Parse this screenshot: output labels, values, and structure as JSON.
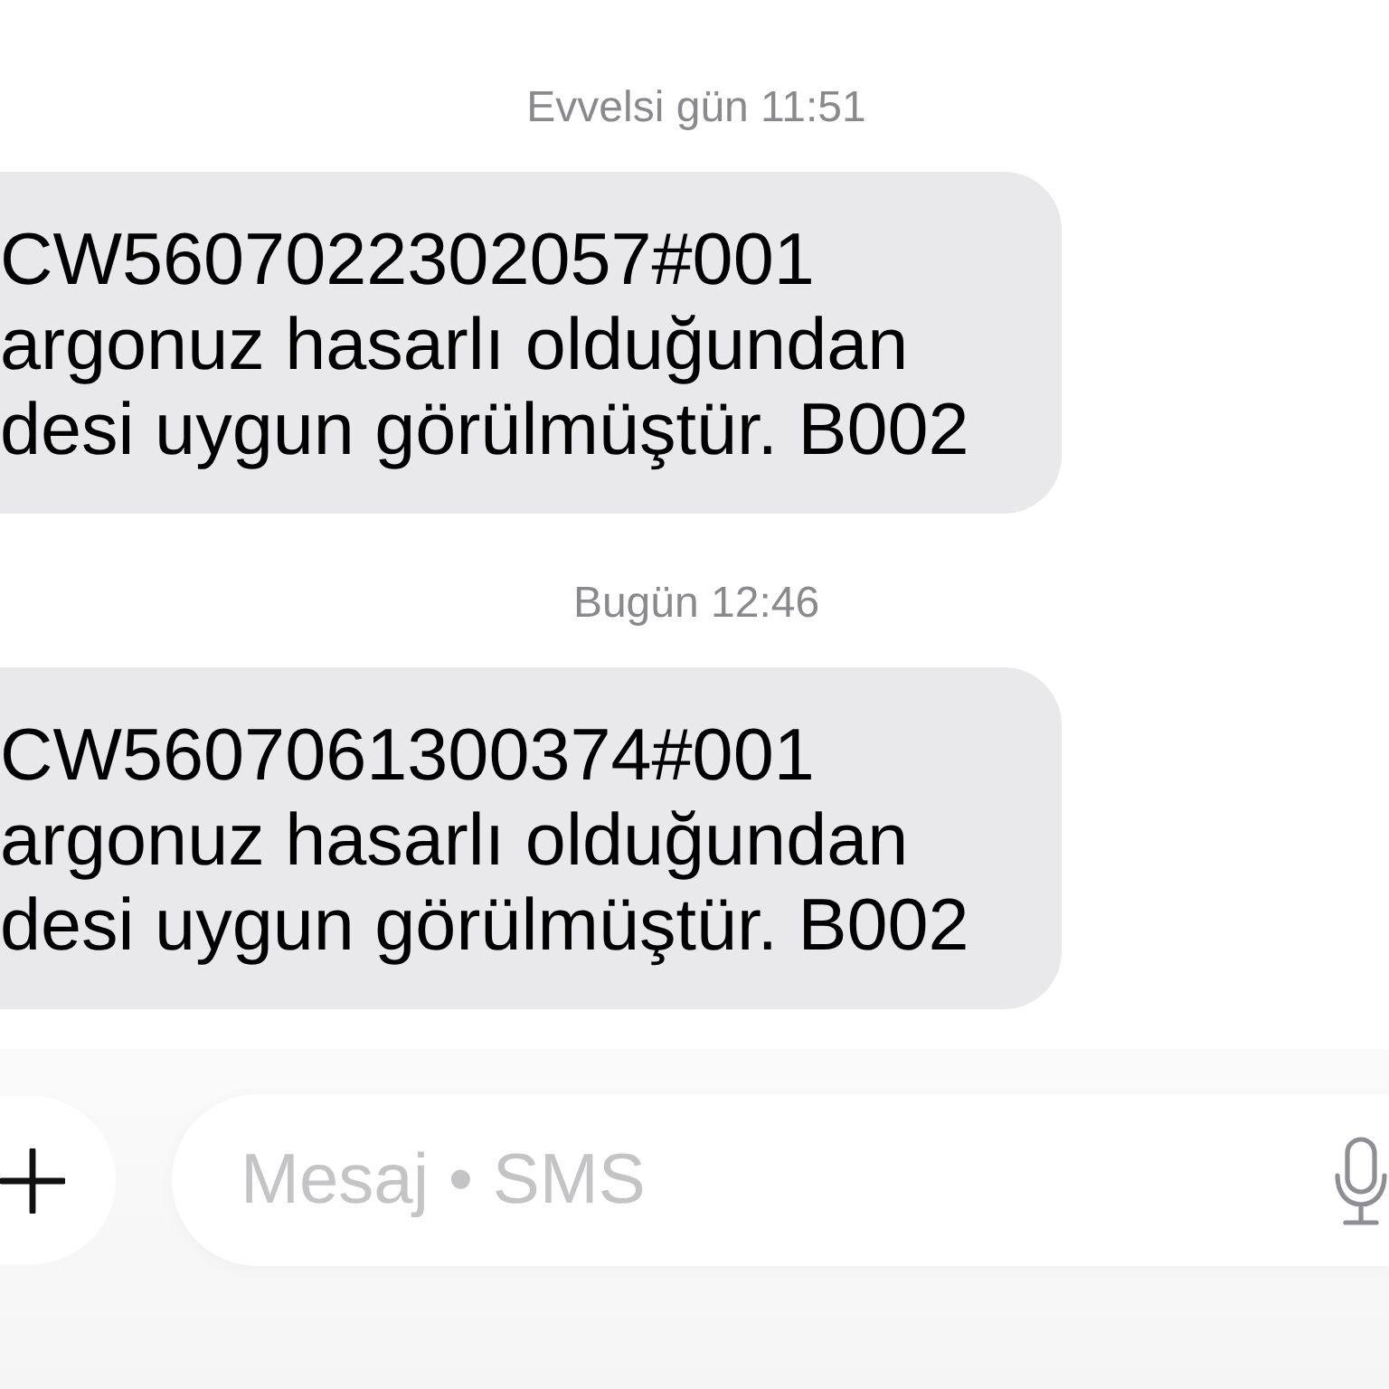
{
  "messages": [
    {
      "timestamp": "Evvelsi gün 11:51",
      "lines": [
        "CW5607022302057#001",
        "argonuz hasarlı olduğundan",
        "desi uygun görülmüştür. B002"
      ]
    },
    {
      "timestamp": "Bugün 12:46",
      "lines": [
        "CW5607061300374#001",
        "argonuz hasarlı olduğundan",
        "desi uygun görülmüştür. B002"
      ]
    }
  ],
  "composer": {
    "placeholder": "Mesaj • SMS"
  }
}
